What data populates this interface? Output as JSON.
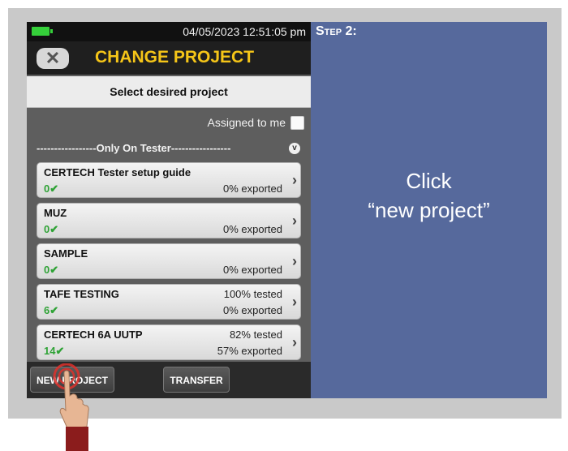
{
  "device": {
    "datetime": "04/05/2023 12:51:05 pm",
    "title": "CHANGE PROJECT",
    "back_icon": "close-icon",
    "subheader": "Select desired project",
    "assigned_label": "Assigned to me",
    "section_label": "-----------------Only On Tester-----------------",
    "projects": [
      {
        "name": "CERTECH Tester setup guide",
        "count": "0✔",
        "tested": "",
        "exported": "0% exported"
      },
      {
        "name": "MUZ",
        "count": "0✔",
        "tested": "",
        "exported": "0% exported"
      },
      {
        "name": "SAMPLE",
        "count": "0✔",
        "tested": "",
        "exported": "0% exported"
      },
      {
        "name": "TAFE TESTING",
        "count": "6✔",
        "tested": "100% tested",
        "exported": "0% exported"
      },
      {
        "name": "CERTECH 6A UUTP",
        "count": "14✔",
        "tested": "82% tested",
        "exported": "57% exported"
      }
    ],
    "new_project_label": "NEW PROJECT",
    "transfer_label": "TRANSFER"
  },
  "instruction": {
    "step": "Step 2:",
    "line1": "Click",
    "line2": "“new project”"
  },
  "colors": {
    "accent": "#f5c518",
    "panel": "#56699c",
    "ok": "#2fa336"
  }
}
